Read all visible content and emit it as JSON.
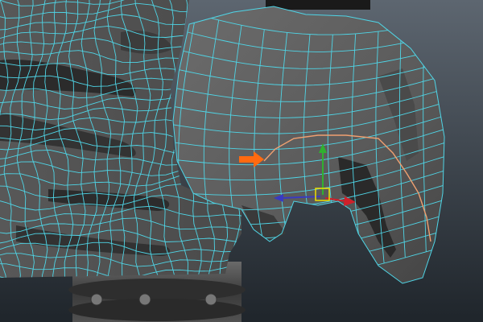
{
  "viewport": {
    "background_top": "#5d6670",
    "background_bottom": "#1f252b"
  },
  "colors": {
    "mesh_fill": "#5a5a5a",
    "mesh_fill_light": "#6a6a6a",
    "mesh_fill_dark": "#3c3c3c",
    "wireframe": "#4fd5e6",
    "selected_edge_loop": "#f0a070",
    "annotation_arrow": "#ff6a10",
    "manipulator_x_axis": "#d0202a",
    "manipulator_y_axis": "#30b030",
    "manipulator_z_axis": "#3a3ac0",
    "manipulator_center": "#f0e000"
  },
  "icons": {
    "annotation": "orange-arrow-icon",
    "transform": "move-manipulator-icon"
  }
}
